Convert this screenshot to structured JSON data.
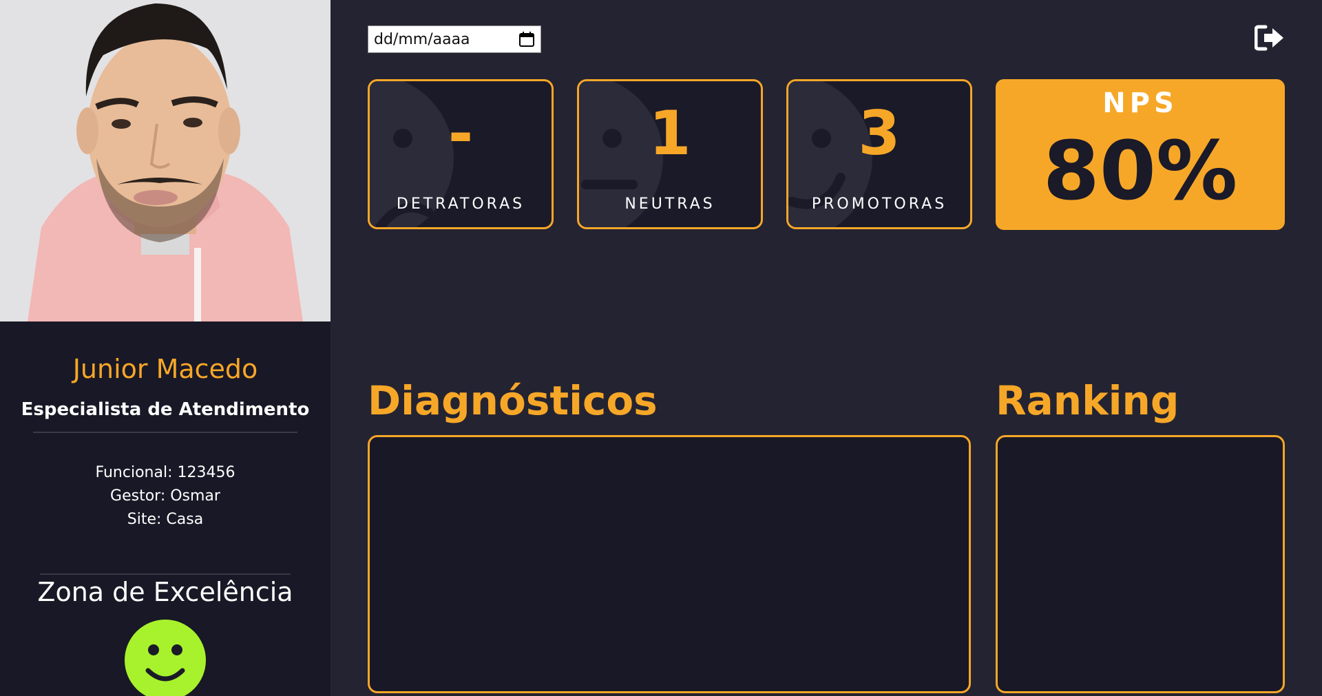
{
  "profile": {
    "name": "Junior Macedo",
    "role": "Especialista de Atendimento",
    "funcional": "Funcional: 123456",
    "gestor": "Gestor: Osmar",
    "site": "Site: Casa",
    "zone": "Zona de Excelência"
  },
  "filters": {
    "date_placeholder": "dd/mm/aaaa"
  },
  "stats": {
    "detratoras": {
      "value": "-",
      "label": "DETRATORAS"
    },
    "neutras": {
      "value": "1",
      "label": "NEUTRAS"
    },
    "promotoras": {
      "value": "3",
      "label": "PROMOTORAS"
    },
    "nps": {
      "title": "NPS",
      "value": "80%"
    }
  },
  "sections": {
    "diagnosticos": "Diagnósticos",
    "ranking": "Ranking"
  },
  "icons": {
    "logout": "logout-icon",
    "calendar": "calendar-icon"
  },
  "colors": {
    "accent": "#f7a728",
    "background": "#242331",
    "panel": "#191826",
    "zone_face": "#a7f22c"
  }
}
